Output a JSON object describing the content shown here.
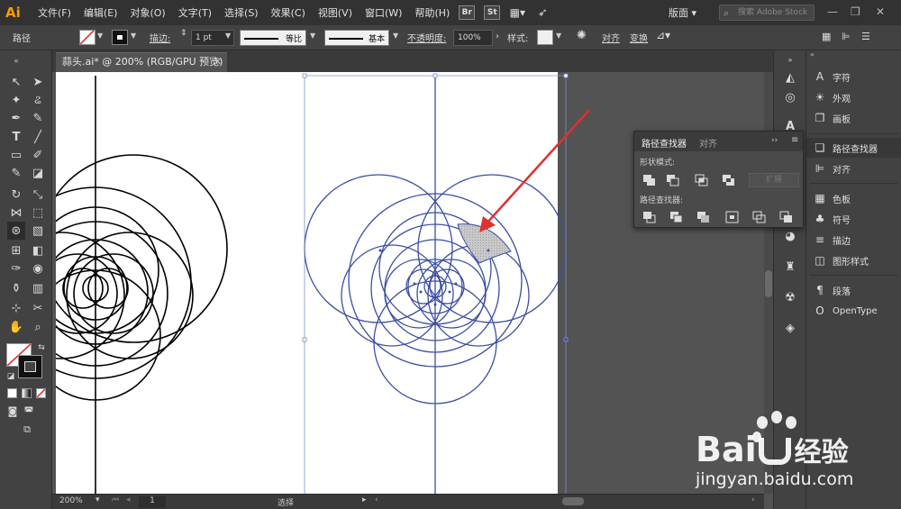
{
  "menubar": {
    "logo": "Ai",
    "menus": [
      "文件(F)",
      "编辑(E)",
      "对象(O)",
      "文字(T)",
      "选择(S)",
      "效果(C)",
      "视图(V)",
      "窗口(W)",
      "帮助(H)"
    ],
    "bridge_label": "Br",
    "stock_label": "St",
    "workspace": "版面",
    "search_placeholder": "搜索 Adobe Stock"
  },
  "controlbar": {
    "selection_type": "路径",
    "stroke_label": "描边",
    "stroke_weight": "1 pt",
    "profile_label": "等比",
    "brush_label": "基本",
    "opacity_label": "不透明度",
    "opacity_value": "100%",
    "style_label": "样式",
    "align_label": "对齐",
    "transform_label": "变换"
  },
  "document": {
    "tab_title": "蒜头.ai* @ 200% (RGB/GPU 预览)"
  },
  "statusbar": {
    "zoom": "200%",
    "artboard_number": "1",
    "mode": "选择"
  },
  "pathfinder_panel": {
    "tab_active": "路径查找器",
    "tab_other": "对齐",
    "shape_modes_label": "形状模式",
    "pathfinders_label": "路径查找器",
    "expand_label": "扩展"
  },
  "right_panels": [
    {
      "icon": "character-icon",
      "glyph": "A",
      "label": "字符"
    },
    {
      "icon": "appearance-icon",
      "glyph": "☀",
      "label": "外观"
    },
    {
      "icon": "artboards-icon",
      "glyph": "❐",
      "label": "画板"
    },
    {
      "icon": "pathfinder-icon",
      "glyph": "❏",
      "label": "路径查找器"
    },
    {
      "icon": "align-icon",
      "glyph": "⊫",
      "label": "对齐"
    },
    {
      "icon": "swatches-icon",
      "glyph": "▦",
      "label": "色板"
    },
    {
      "icon": "symbols-icon",
      "glyph": "♣",
      "label": "符号"
    },
    {
      "icon": "stroke-icon",
      "glyph": "≡",
      "label": "描边"
    },
    {
      "icon": "graphic-styles-icon",
      "glyph": "◫",
      "label": "图形样式"
    },
    {
      "icon": "paragraph-icon",
      "glyph": "¶",
      "label": "段落"
    },
    {
      "icon": "opentype-icon",
      "glyph": "O",
      "label": "OpenType"
    }
  ],
  "watermark": {
    "brand": "Bai",
    "brand_cn": "经验",
    "url": "jingyan.baidu.com"
  },
  "colors": {
    "accent": "#ff9a00",
    "selection_blue": "#3b4ea0",
    "arrow_red": "#e03030"
  }
}
